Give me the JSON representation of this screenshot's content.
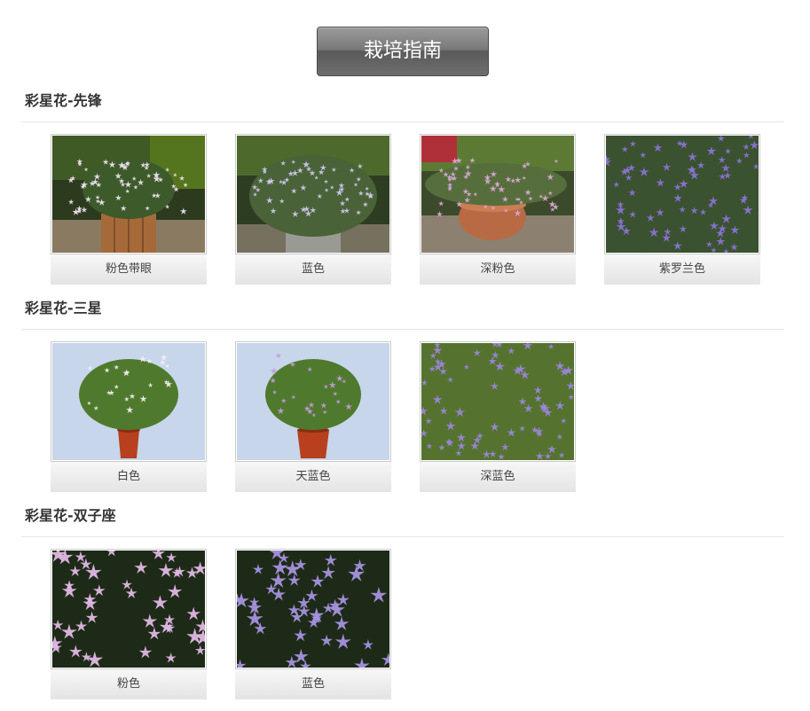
{
  "guide_button": {
    "label": "栽培指南"
  },
  "sections": [
    {
      "title": "彩星花-先锋",
      "items": [
        {
          "caption": "粉色带眼",
          "color": "#f0e4f2"
        },
        {
          "caption": "蓝色",
          "color": "#cfc8ec"
        },
        {
          "caption": "深粉色",
          "color": "#d9a9d6"
        },
        {
          "caption": "紫罗兰色",
          "color": "#8b73d6"
        }
      ]
    },
    {
      "title": "彩星花-三星",
      "items": [
        {
          "caption": "白色",
          "color": "#f6eef4"
        },
        {
          "caption": "天蓝色",
          "color": "#c69bdc"
        },
        {
          "caption": "深蓝色",
          "color": "#9b86db"
        }
      ]
    },
    {
      "title": "彩星花-双子座",
      "items": [
        {
          "caption": "粉色",
          "color": "#e0b8e4"
        },
        {
          "caption": "蓝色",
          "color": "#a592de"
        }
      ]
    }
  ]
}
